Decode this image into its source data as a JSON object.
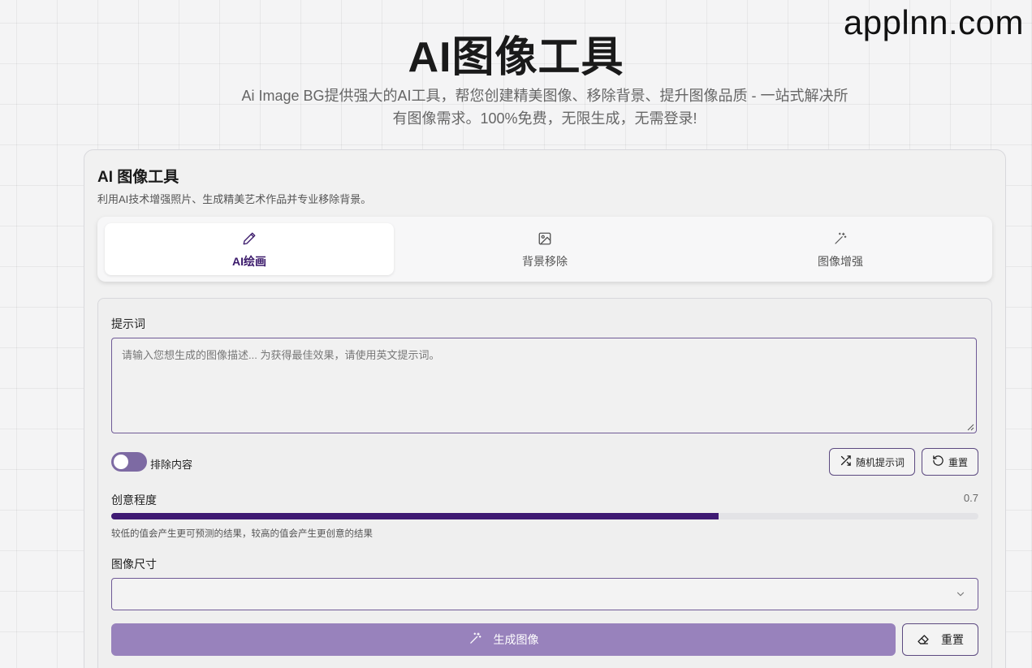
{
  "watermark": "applnn.com",
  "hero": {
    "title": "AI图像工具",
    "subtitle": "Ai Image BG提供强大的AI工具，帮您创建精美图像、移除背景、提升图像品质 - 一站式解决所有图像需求。100%免费，无限生成，无需登录!"
  },
  "card": {
    "title": "AI 图像工具",
    "description": "利用AI技术增强照片、生成精美艺术作品并专业移除背景。"
  },
  "tabs": [
    {
      "label": "AI绘画",
      "icon": "pencil-icon",
      "active": true
    },
    {
      "label": "背景移除",
      "icon": "image-icon",
      "active": false
    },
    {
      "label": "图像增强",
      "icon": "magic-wand-icon",
      "active": false
    }
  ],
  "form": {
    "prompt_label": "提示词",
    "prompt_value": "",
    "prompt_placeholder": "请输入您想生成的图像描述... 为获得最佳效果，请使用英文提示词。",
    "exclude_toggle": {
      "label": "排除内容",
      "enabled": false
    },
    "random_button": "随机提示词",
    "reset_button": "重置",
    "creativity": {
      "label": "创意程度",
      "value_text": "0.7",
      "value": 0.7,
      "min": 0,
      "max": 1,
      "hint": "较低的值会产生更可预测的结果，较高的值会产生更创意的结果"
    },
    "size_label": "图像尺寸",
    "size_selected": "",
    "generate_button": "生成图像",
    "reset_button_2": "重置"
  },
  "colors": {
    "accent": "#3f1a73",
    "primary_button": "#9882bc",
    "toggle_track": "#7d6aa3",
    "border": "#6f5a96"
  }
}
